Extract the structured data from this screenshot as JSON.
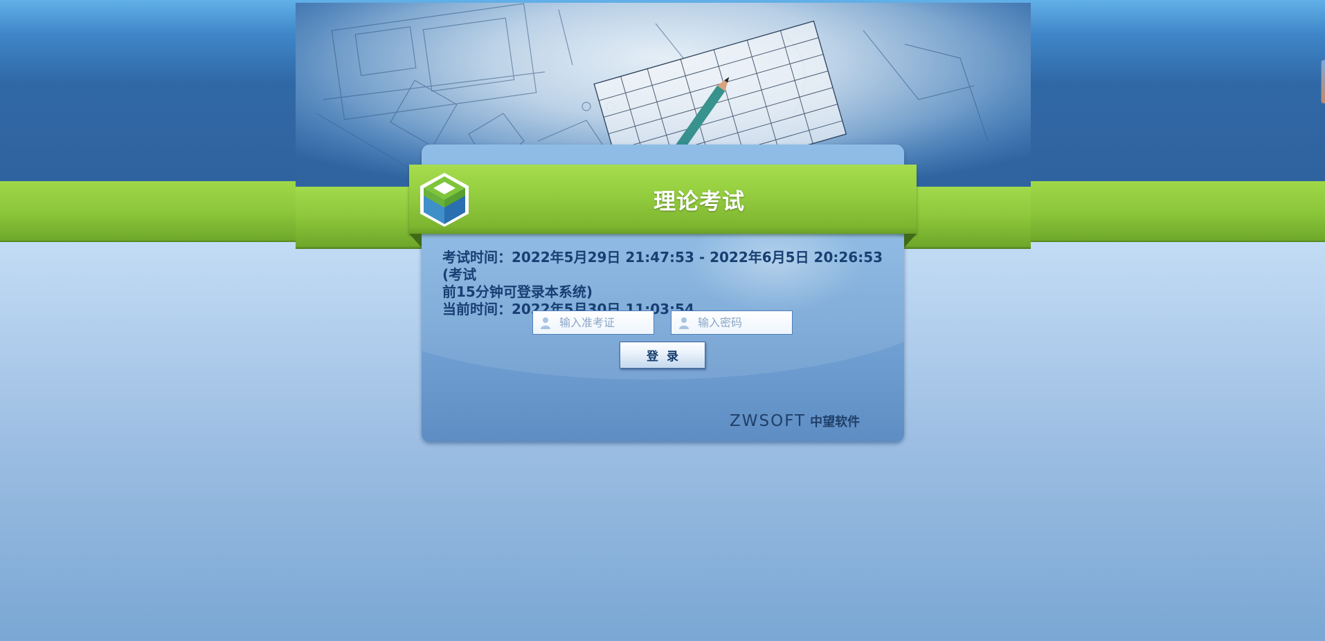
{
  "app": {
    "title": "理论考试"
  },
  "exam": {
    "time_line1": "考试时间：2022年5月29日 21:47:53 - 2022年6月5日 20:26:53 (考试",
    "time_line2": "前15分钟可登录本系统)",
    "current_time": "当前时间：2022年5月30日 11:03:54"
  },
  "form": {
    "ticket_placeholder": "输入准考证",
    "password_placeholder": "输入密码",
    "login_label": "登录"
  },
  "brand": {
    "latin": "ZWSOFT",
    "chinese": "中望软件"
  },
  "colors": {
    "green": "#8cc63a",
    "blue": "#2f639f",
    "text": "#183f72"
  }
}
